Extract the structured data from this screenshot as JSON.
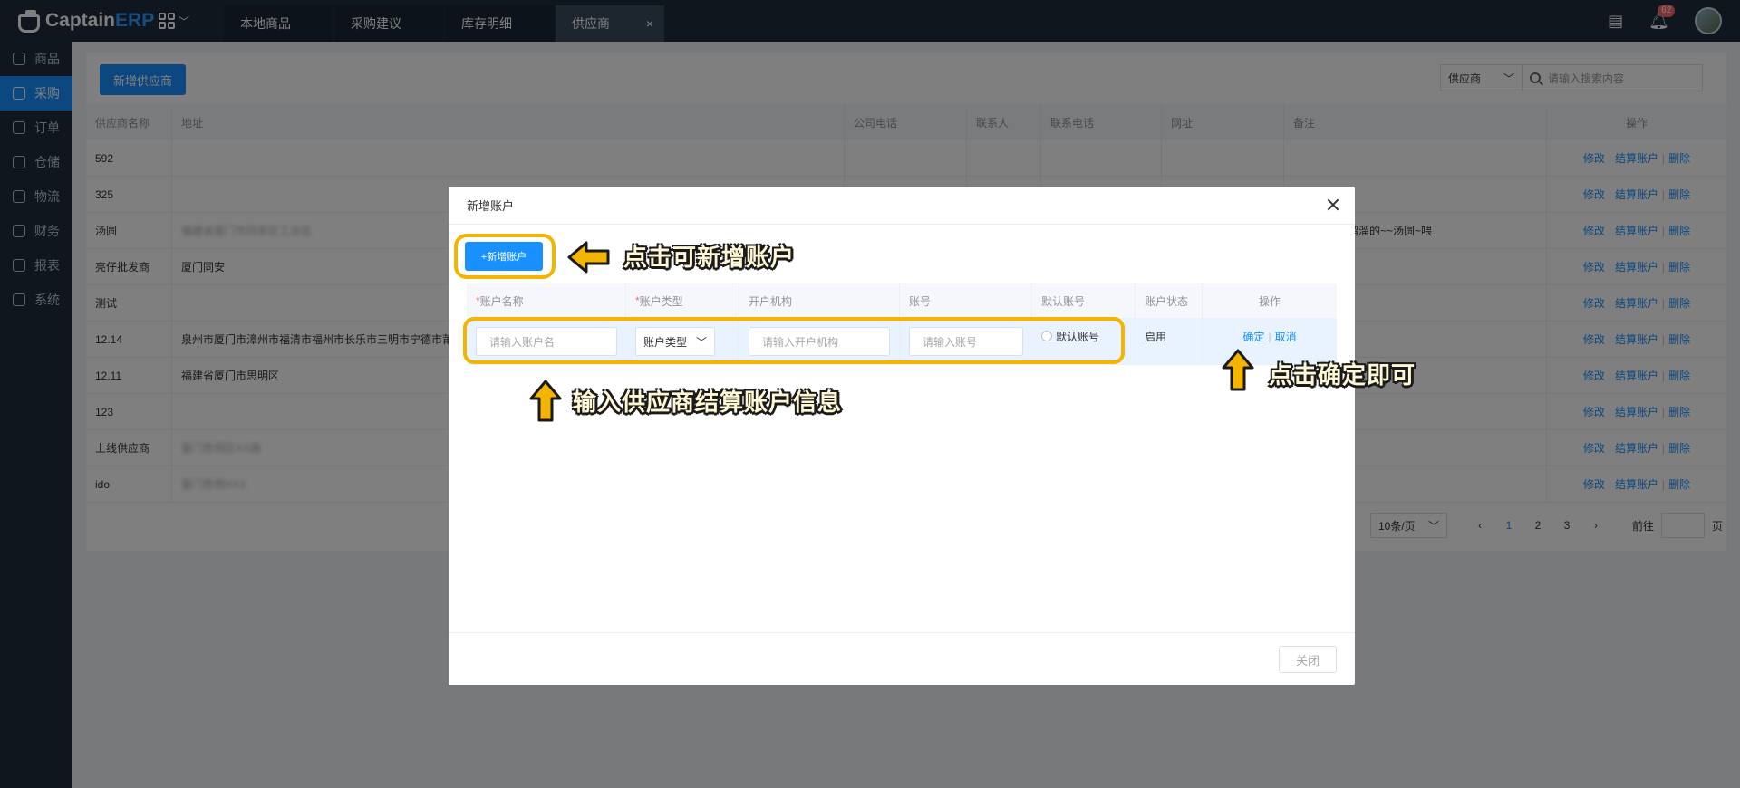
{
  "topbar": {
    "logo_captain": "Captain",
    "logo_erp": "ERP",
    "tabs": [
      {
        "label": "本地商品"
      },
      {
        "label": "采购建议"
      },
      {
        "label": "库存明细"
      },
      {
        "label": "供应商",
        "close": "×"
      }
    ],
    "notification_count": "62"
  },
  "sidebar": {
    "items": [
      {
        "label": "商品"
      },
      {
        "label": "采购"
      },
      {
        "label": "订单"
      },
      {
        "label": "仓储"
      },
      {
        "label": "物流"
      },
      {
        "label": "财务"
      },
      {
        "label": "报表"
      },
      {
        "label": "系统"
      }
    ]
  },
  "main": {
    "add_supplier_label": "新增供应商",
    "filter_select": "供应商",
    "search_placeholder": "请输入搜索内容",
    "columns": [
      "供应商名称",
      "地址",
      "公司电话",
      "联系人",
      "联系电话",
      "网址",
      "备注",
      "操作"
    ],
    "rows": [
      {
        "name": "592",
        "address": "",
        "note": ""
      },
      {
        "name": "325",
        "address": "",
        "note": ""
      },
      {
        "name": "汤圆",
        "address": "福建省厦门市同安区工业区",
        "note": "汤圆喂、滑溜溜的~~汤圆~喂"
      },
      {
        "name": "亮仔批发商",
        "address": "厦门同安",
        "note": ""
      },
      {
        "name": "测试",
        "address": "",
        "note": ""
      },
      {
        "name": "12.14",
        "address": "泉州市厦门市漳州市福清市福州市长乐市三明市宁德市莆田",
        "note": ""
      },
      {
        "name": "12.11",
        "address": "福建省厦门市思明区",
        "note": ""
      },
      {
        "name": "123",
        "address": "",
        "note": ""
      },
      {
        "name": "上线供应商",
        "address": "厦门思明区XX路",
        "note": ""
      },
      {
        "name": "ido",
        "address": "厦门思明XXX",
        "note": ""
      }
    ],
    "row_ops": {
      "edit": "修改",
      "accounts": "结算账户",
      "delete": "删除"
    },
    "pager": {
      "size": "10条/页",
      "pages": [
        "1",
        "2",
        "3"
      ],
      "goto": "前往",
      "page_unit": "页"
    }
  },
  "dialog": {
    "title": "新增账户",
    "new_account_label": "+新增账户",
    "columns": [
      {
        "required": "*",
        "label": "账户名称"
      },
      {
        "required": "*",
        "label": "账户类型"
      },
      {
        "required": "",
        "label": "开户机构"
      },
      {
        "required": "",
        "label": "账号"
      },
      {
        "required": "",
        "label": "默认账号"
      },
      {
        "required": "",
        "label": "账户状态"
      },
      {
        "required": "",
        "label": "操作"
      }
    ],
    "row": {
      "name_placeholder": "请输入账户名",
      "type_select": "账户类型",
      "org_placeholder": "请输入开户机构",
      "number_placeholder": "请输入账号",
      "default_label": "默认账号",
      "status": "启用",
      "confirm": "确定",
      "cancel": "取消"
    },
    "close_label": "关闭"
  },
  "annotations": {
    "new_account_hint": "点击可新增账户",
    "input_hint": "输入供应商结算账户信息",
    "confirm_hint": "点击确定即可"
  },
  "colors": {
    "accent": "#1890ff",
    "highlight": "#f5b400",
    "sidebar": "#1f2d3d"
  }
}
